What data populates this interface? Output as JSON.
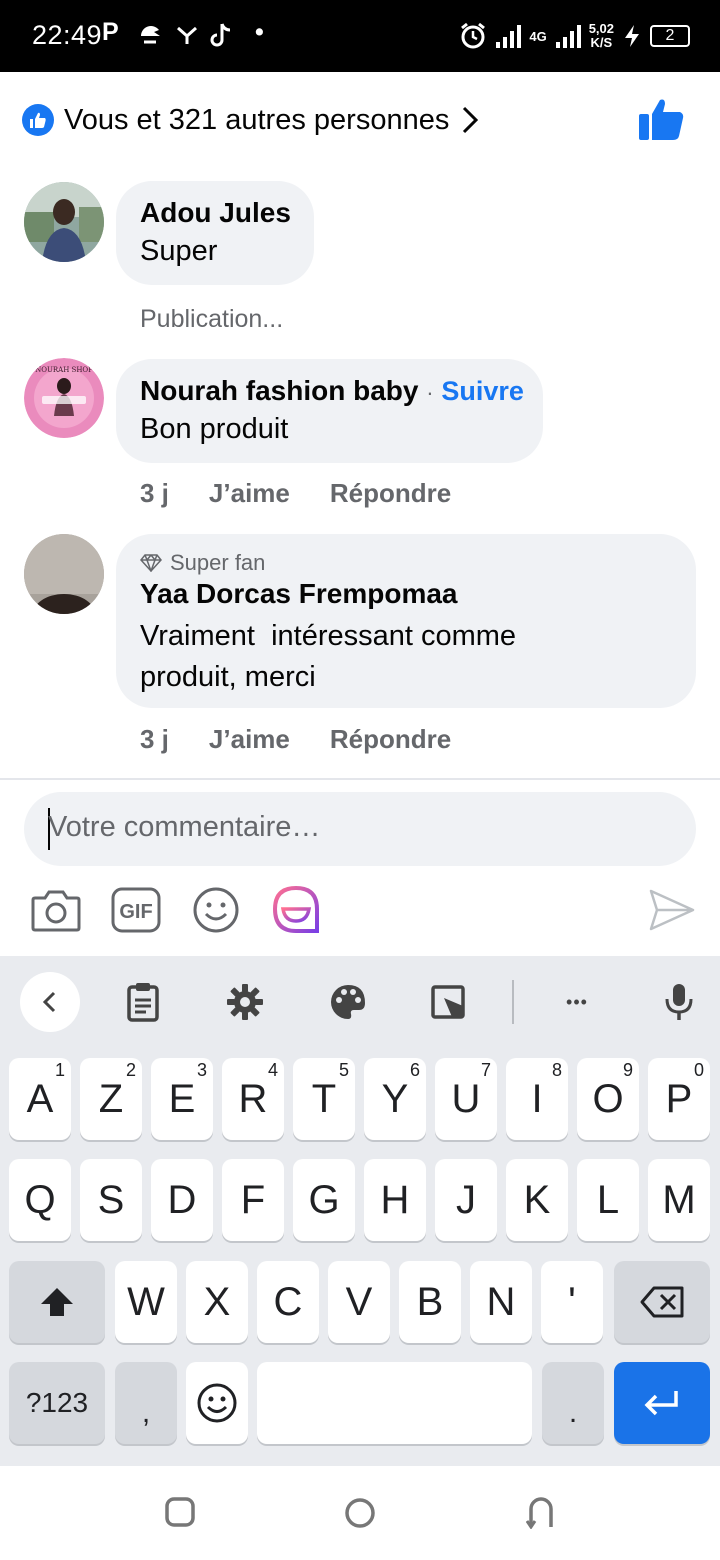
{
  "status_bar": {
    "time": "22:49",
    "app_icons": [
      "P",
      "⮈",
      "Y",
      "♪",
      "•"
    ],
    "network": "4G",
    "speed": "5,02",
    "speed_unit": "K/S",
    "battery": "2"
  },
  "reactions": {
    "summary": "Vous et 321 autres personnes",
    "icon": "like-icon"
  },
  "comments": [
    {
      "author": "Adou Jules",
      "text": "Super",
      "note": "Publication..."
    },
    {
      "author": "Nourah fashion baby",
      "separator": "·",
      "follow_label": "Suivre",
      "text": "Bon produit",
      "time": "3 j",
      "like_label": "J’aime",
      "reply_label": "Répondre",
      "avatar_text": "NOURAH SHOP"
    },
    {
      "badge": "Super fan",
      "author": "Yaa Dorcas Frempomaa",
      "text": "Vraiment  intéressant comme produit, merci",
      "time": "3 j",
      "like_label": "J’aime",
      "reply_label": "Répondre"
    }
  ],
  "composer": {
    "placeholder": "Votre commentaire…",
    "tools": [
      "camera-icon",
      "gif-icon",
      "smiley-icon",
      "avatar-sticker-icon",
      "send-icon"
    ],
    "gif_label": "GIF"
  },
  "keyboard": {
    "toolbar": [
      "back-icon",
      "clipboard-icon",
      "settings-icon",
      "palette-icon",
      "resize-icon",
      "more-icon",
      "mic-icon"
    ],
    "more_label": "•••",
    "row1": [
      {
        "key": "A",
        "hint": "1"
      },
      {
        "key": "Z",
        "hint": "2"
      },
      {
        "key": "E",
        "hint": "3"
      },
      {
        "key": "R",
        "hint": "4"
      },
      {
        "key": "T",
        "hint": "5"
      },
      {
        "key": "Y",
        "hint": "6"
      },
      {
        "key": "U",
        "hint": "7"
      },
      {
        "key": "I",
        "hint": "8"
      },
      {
        "key": "O",
        "hint": "9"
      },
      {
        "key": "P",
        "hint": "0"
      }
    ],
    "row2": [
      "Q",
      "S",
      "D",
      "F",
      "G",
      "H",
      "J",
      "K",
      "L",
      "M"
    ],
    "row3": [
      "W",
      "X",
      "C",
      "V",
      "B",
      "N",
      "'"
    ],
    "symbols_label": "?123",
    "comma": ",",
    "period": "."
  },
  "colors": {
    "accent": "#1877f2",
    "bubble": "#f0f2f5",
    "muted": "#65676b",
    "enter": "#1a73e8"
  }
}
